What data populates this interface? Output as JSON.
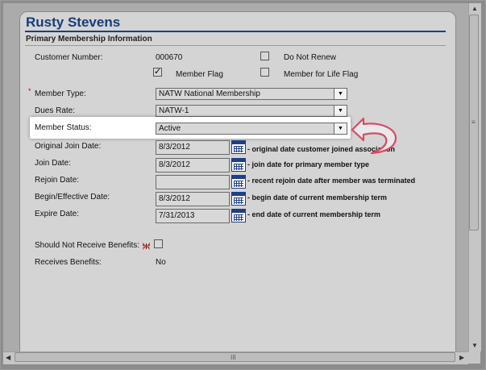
{
  "customer": {
    "name": "Rusty Stevens"
  },
  "section": {
    "title": "Primary Membership Information"
  },
  "fields": {
    "customer_number": {
      "label": "Customer Number:",
      "value": "000670"
    },
    "do_not_renew": {
      "label": "Do Not Renew",
      "checked": false
    },
    "member_flag": {
      "label": "Member Flag",
      "checked": true,
      "mark": "✓"
    },
    "member_for_life": {
      "label": "Member for Life Flag",
      "checked": false
    },
    "member_type": {
      "label": "Member Type:",
      "required_mark": "*",
      "value": "NATW National Membership"
    },
    "dues_rate": {
      "label": "Dues Rate:",
      "value": "NATW-1"
    },
    "member_status": {
      "label": "Member Status:",
      "value": "Active"
    },
    "original_join_date": {
      "label": "Original Join Date:",
      "value": "8/3/2012",
      "hint": "- original date customer joined association"
    },
    "join_date": {
      "label": "Join Date:",
      "value": "8/3/2012",
      "hint": "- join date for primary member type"
    },
    "rejoin_date": {
      "label": "Rejoin Date:",
      "value": "",
      "hint": "- recent rejoin date after member was terminated"
    },
    "begin_date": {
      "label": "Begin/Effective Date:",
      "value": "8/3/2012",
      "hint": "- begin date of current membership term"
    },
    "expire_date": {
      "label": "Expire Date:",
      "value": "7/31/2013",
      "hint": "- end date of current membership term"
    },
    "should_not_receive_benefits": {
      "label": "Should Not Receive Benefits:",
      "checked": false
    },
    "receives_benefits": {
      "label": "Receives Benefits:",
      "value": "No"
    }
  },
  "icons": {
    "dropdown": "chevron-down-icon",
    "calendar": "calendar-icon",
    "benefits": "butterfly-icon",
    "pointer": "curved-arrow-icon"
  },
  "scrollbar": {
    "grip": "III",
    "grip_vertical": "≡"
  },
  "colors": {
    "title": "#163c7a",
    "rule": "#1b3f86",
    "required": "#c00000",
    "pointer": "#e0506a"
  }
}
